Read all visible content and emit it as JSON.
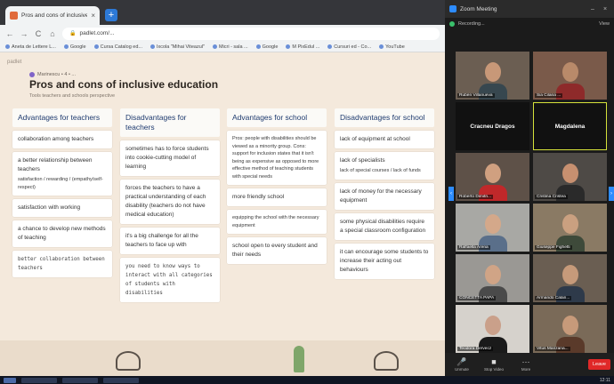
{
  "browser": {
    "tab_title": "Pros and cons of inclusive educ",
    "tab_close": "×",
    "new_tab": "+",
    "back": "←",
    "forward": "→",
    "reload": "C",
    "home": "⌂",
    "url": "padlet.com/...",
    "bookmarks": [
      "Aneta de Lettere L...",
      "Google",
      "Cursa Catalog ed...",
      "Ixcola \"Mihai Viteazul\"",
      "Micri - sala ...",
      "Google",
      "M PixEdul ...",
      "Cursuri ed - Co...",
      "YouTube"
    ]
  },
  "padlet": {
    "brand": "padlet",
    "author": "Marinescu • 4 • ...",
    "title": "Pros and cons of inclusive education",
    "subtitle": "Tools teachers and schools perspective",
    "columns": [
      {
        "header": "Advantages for teachers",
        "posts": [
          {
            "text": "collaboration among teachers",
            "style": "normal"
          },
          {
            "text": "a better relationship between teachers",
            "style": "normal",
            "extra": "satisfaction / rewarding / (empathy/self-respect)"
          },
          {
            "text": "satisfaction with working",
            "style": "normal"
          },
          {
            "text": "a chance to develop new methods of teaching",
            "style": "normal"
          },
          {
            "text": "better collaboration between teachers",
            "style": "mono"
          }
        ]
      },
      {
        "header": "Disadvantages for teachers",
        "posts": [
          {
            "text": "sometimes has to force students into cookie-cutting model of learning",
            "style": "normal"
          },
          {
            "text": "forces the teachers to have a practical understanding of each disability (teachers do not have medical education)",
            "style": "normal"
          },
          {
            "text": "it's a big challenge for all the teachers to face up with",
            "style": "normal"
          },
          {
            "text": "you need to know ways to interact with all categories of students with disabilities",
            "style": "mono"
          }
        ]
      },
      {
        "header": "Advantages for school",
        "posts": [
          {
            "text": "Pros: people with disabilities should be viewed as a minority group. Cons: support for inclusion states that it isn't being as expensive as opposed to more effective method of teaching students with special needs",
            "style": "small"
          },
          {
            "text": "more friendly school",
            "style": "normal"
          },
          {
            "text": "equipping the school with the necessary equipment",
            "style": "small"
          },
          {
            "text": "school open to every student and their needs",
            "style": "normal"
          }
        ]
      },
      {
        "header": "Disadvantages for school",
        "posts": [
          {
            "text": "lack of equipment at school",
            "style": "normal"
          },
          {
            "text": "lack of specialists",
            "style": "normal",
            "extra": "lack of special courses / lack of funds"
          },
          {
            "text": "lack of money for the necessary equipment",
            "style": "normal"
          },
          {
            "text": "some physical disabilities require a special classroom configuration",
            "style": "normal"
          },
          {
            "text": "it can encourage some students to increase their acting out behaviours",
            "style": "normal"
          }
        ]
      }
    ]
  },
  "zoom": {
    "window_title": "Zoom Meeting",
    "recording": "Recording...",
    "view": "View",
    "participants": [
      {
        "name": "Rubén Villanueva",
        "video": true,
        "bg": "#6b5e52",
        "skin": "#c89878",
        "shirt": "#37474f"
      },
      {
        "name": "Sia Cilana ...",
        "video": true,
        "bg": "#7a5a4a",
        "skin": "#b98a6a",
        "shirt": "#8e2a2a"
      },
      {
        "name": "Cracneu Dragos",
        "video": false
      },
      {
        "name": "Magdalena",
        "video": false,
        "highlight": true
      },
      {
        "name": "Roberto Dimitri...",
        "video": true,
        "bg": "#5e5148",
        "skin": "#d0a080",
        "shirt": "#c0282a"
      },
      {
        "name": "Cristina Cristea",
        "video": true,
        "bg": "#4e4a46",
        "skin": "#c79070",
        "shirt": "#2a2a2a"
      },
      {
        "name": "Raffaella Arena",
        "video": true,
        "bg": "#a8a8a4",
        "skin": "#d4a88a",
        "shirt": "#5a6f8a"
      },
      {
        "name": "Giuseppe Fighetti",
        "video": true,
        "bg": "#8a7a64",
        "skin": "#caa080",
        "shirt": "#3e4a3a"
      },
      {
        "name": "CONCETTA PAPA",
        "video": true,
        "bg": "#9a9894",
        "skin": "#d0a486",
        "shirt": "#4a4a4a"
      },
      {
        "name": "Armando Calan...",
        "video": true,
        "bg": "#6a5e52",
        "skin": "#c69a7a",
        "shirt": "#2e3a4a"
      },
      {
        "name": "Teodora Dervecz",
        "video": true,
        "bg": "#d6d2cc",
        "skin": "#caa08a",
        "shirt": "#1a1a1a"
      },
      {
        "name": "Vitus Manzana...",
        "video": true,
        "bg": "#7a6a58",
        "skin": "#c79a7a",
        "shirt": "#5a3a2a"
      }
    ],
    "controls": {
      "unmute": "Unmute",
      "video": "Stop Video",
      "more": "More",
      "leave": "Leave"
    }
  },
  "taskbar": {
    "clock": "12:11"
  }
}
